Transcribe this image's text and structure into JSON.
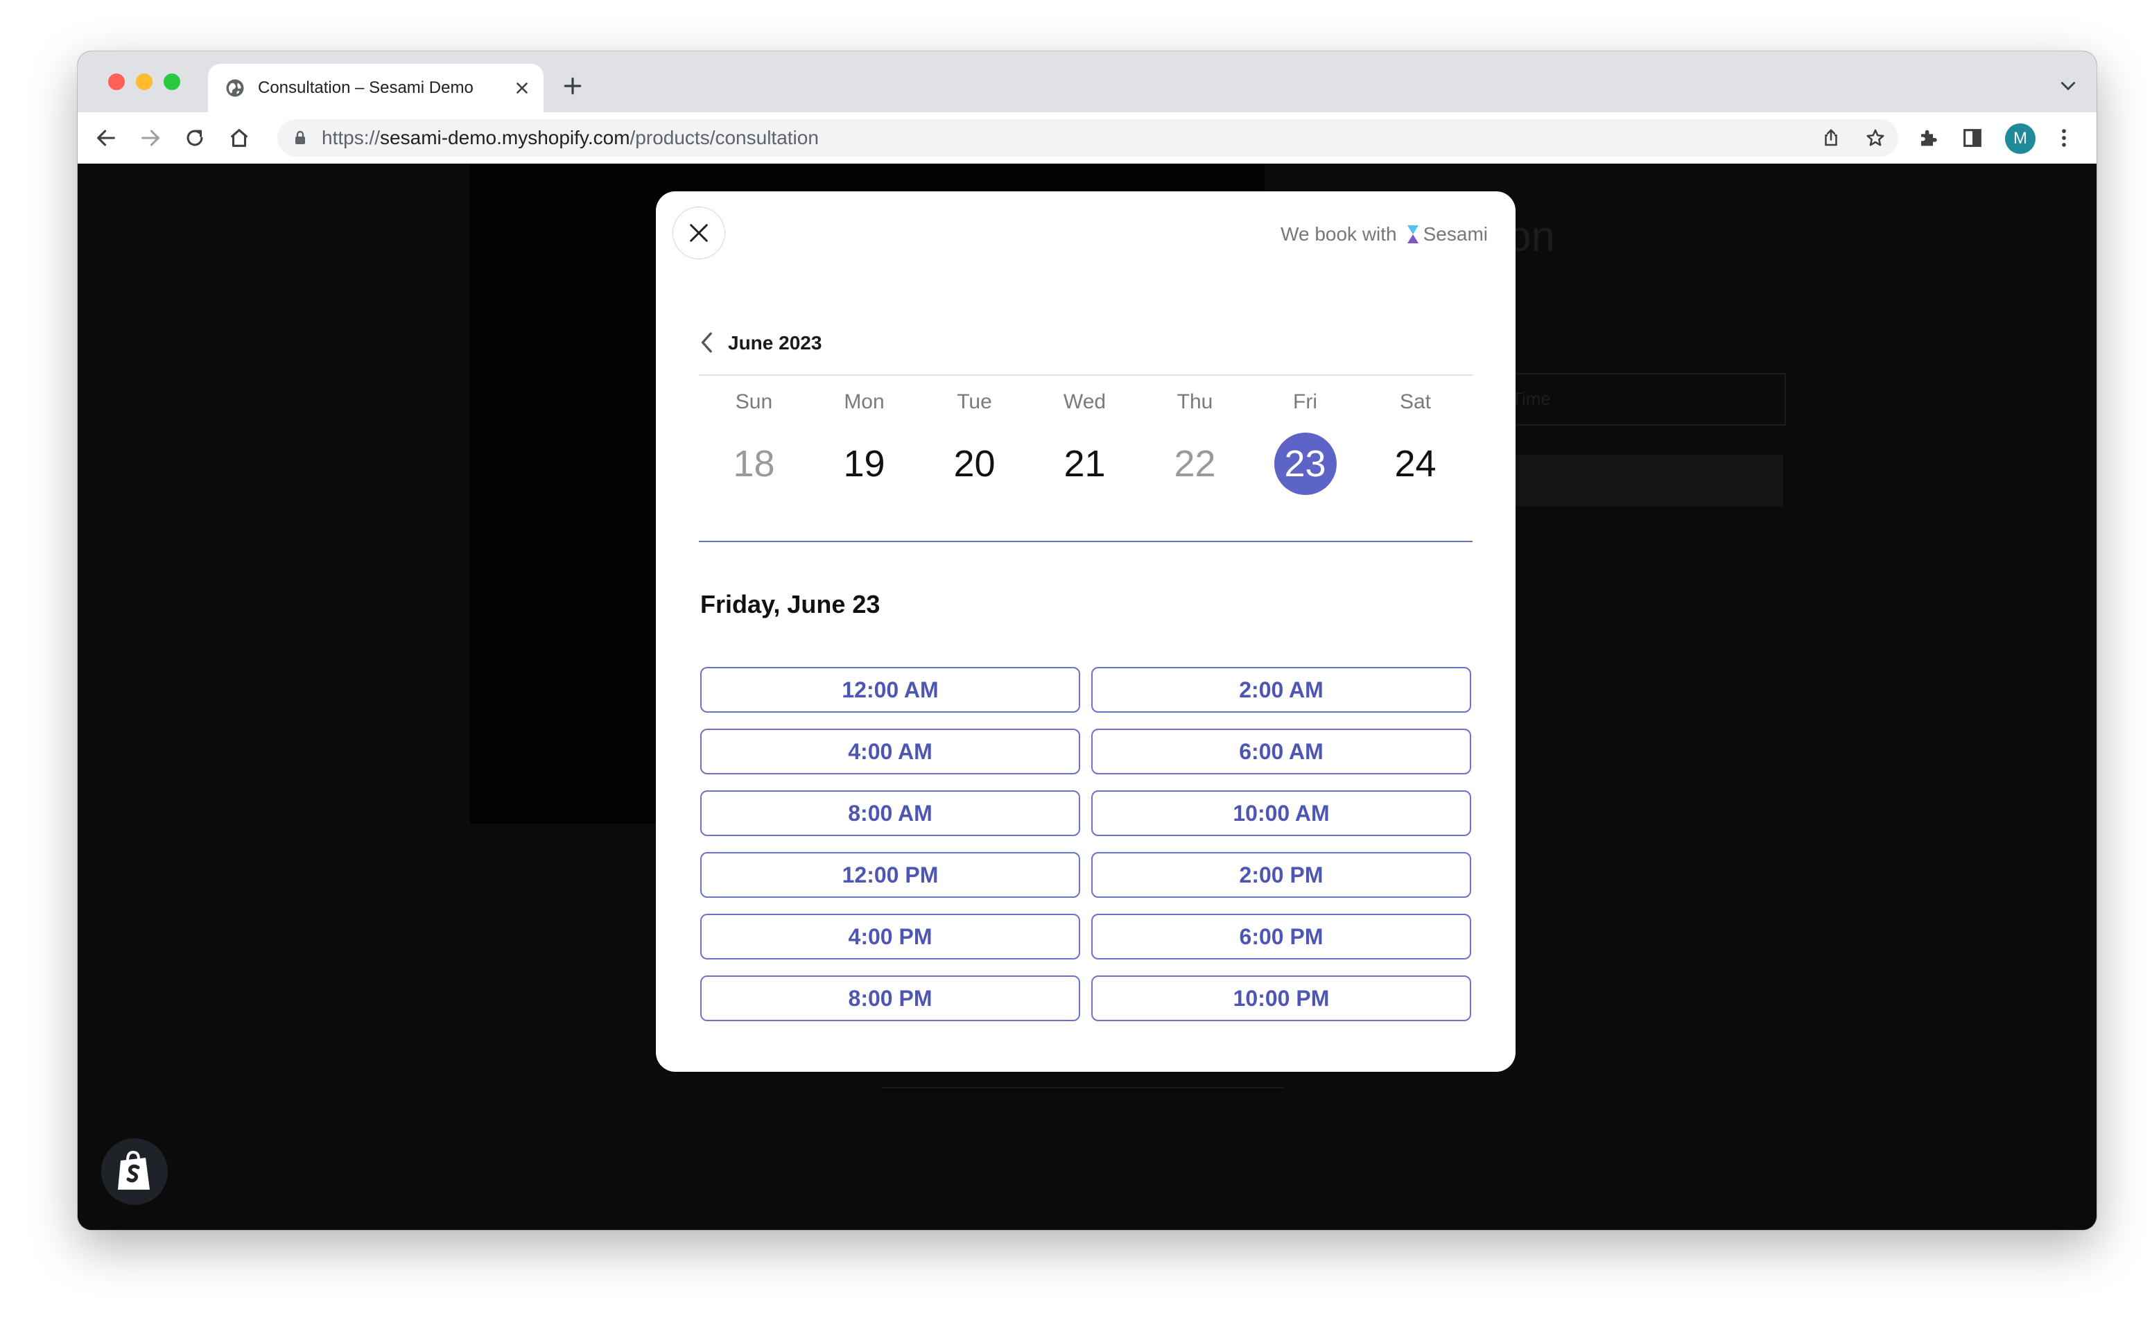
{
  "browser": {
    "tab_title": "Consultation – Sesami Demo",
    "url_scheme": "https://",
    "url_host": "sesami-demo.myshopify.com",
    "url_path": "/products/consultation",
    "profile_initial": "M"
  },
  "modal": {
    "brand_prefix": "We book with",
    "brand_name": "Sesami",
    "month_label": "June 2023",
    "days": [
      {
        "dow": "Sun",
        "date": "18",
        "state": "disabled"
      },
      {
        "dow": "Mon",
        "date": "19",
        "state": "available"
      },
      {
        "dow": "Tue",
        "date": "20",
        "state": "available"
      },
      {
        "dow": "Wed",
        "date": "21",
        "state": "available"
      },
      {
        "dow": "Thu",
        "date": "22",
        "state": "disabled"
      },
      {
        "dow": "Fri",
        "date": "23",
        "state": "selected"
      },
      {
        "dow": "Sat",
        "date": "24",
        "state": "available"
      }
    ],
    "selected_date_heading": "Friday, June 23",
    "time_slots": [
      "12:00 AM",
      "2:00 AM",
      "4:00 AM",
      "6:00 AM",
      "8:00 AM",
      "10:00 AM",
      "12:00 PM",
      "2:00 PM",
      "4:00 PM",
      "6:00 PM",
      "8:00 PM",
      "10:00 PM"
    ]
  },
  "background_page": {
    "title_fragment": "on",
    "field_placeholder": "Time"
  },
  "colors": {
    "accent": "#5c64c7",
    "slot_text": "#4e56b5",
    "overlay": "#0b0b0b"
  },
  "icons": [
    "globe-icon",
    "close-icon",
    "plus-icon",
    "back-icon",
    "forward-icon",
    "reload-icon",
    "home-icon",
    "lock-icon",
    "share-icon",
    "star-icon",
    "extensions-icon",
    "side-panel-icon",
    "kebab-menu-icon",
    "hourglass-icon",
    "chevron-left-icon",
    "shopify-bag-icon"
  ]
}
